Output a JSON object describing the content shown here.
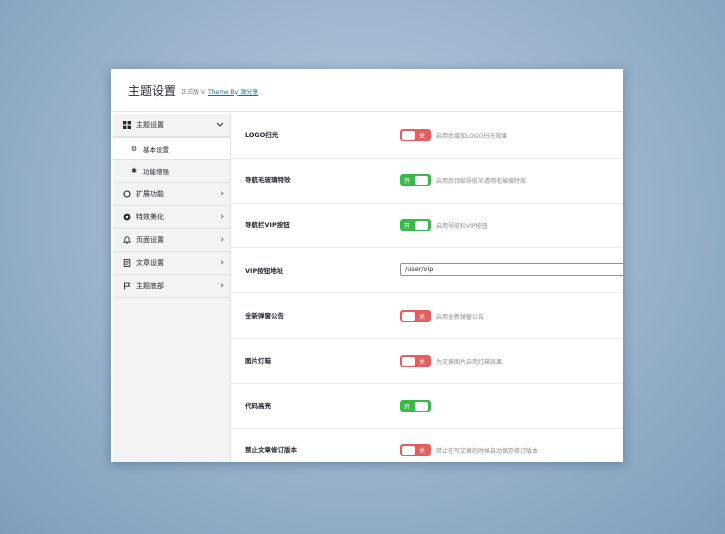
{
  "header": {
    "title": "主题设置",
    "version": "正式版 V",
    "theme_link": "Theme By 源分享"
  },
  "sidebar": {
    "items": [
      {
        "label": "主题设置",
        "icon": "grid-icon",
        "chevron": "﹀",
        "expanded": true,
        "children": [
          {
            "label": "基本设置",
            "icon": "gear-icon",
            "active": true
          },
          {
            "label": "功能增强",
            "icon": "sparkle-icon",
            "active": false
          }
        ]
      },
      {
        "label": "扩展功能",
        "icon": "circle-icon",
        "chevron": "›"
      },
      {
        "label": "特效美化",
        "icon": "dot-circle-icon",
        "chevron": "›"
      },
      {
        "label": "页面设置",
        "icon": "bell-icon",
        "chevron": "›"
      },
      {
        "label": "文章设置",
        "icon": "document-icon",
        "chevron": "›"
      },
      {
        "label": "主题底部",
        "icon": "flag-icon",
        "chevron": "›"
      }
    ]
  },
  "settings": [
    {
      "label": "LOGO扫光",
      "type": "toggle",
      "state": "off",
      "state_text": "关",
      "description": "启用后增加LOGO扫光效果"
    },
    {
      "label": "导航毛玻璃特效",
      "type": "toggle",
      "state": "on",
      "state_text": "开",
      "description": "启用后顶部导航半透明毛玻璃特效"
    },
    {
      "label": "导航栏VIP按钮",
      "type": "toggle",
      "state": "on",
      "state_text": "开",
      "description": "启用导航栏VIP按钮"
    },
    {
      "label": "VIP按钮地址",
      "type": "input",
      "value": "/user/vip"
    },
    {
      "label": "全新弹窗公告",
      "type": "toggle",
      "state": "off",
      "state_text": "关",
      "description": "启用全新弹窗公告"
    },
    {
      "label": "图片灯箱",
      "type": "toggle",
      "state": "off",
      "state_text": "关",
      "description": "为文章图片启用灯箱效果"
    },
    {
      "label": "代码高亮",
      "type": "toggle",
      "state": "on",
      "state_text": "开",
      "description": ""
    },
    {
      "label": "禁止文章修订版本",
      "type": "toggle",
      "state": "off",
      "state_text": "关",
      "description": "禁止在写文章的时候自动保存修订版本"
    }
  ],
  "colors": {
    "toggle_on": "#3cb84a",
    "toggle_off": "#e35f5f",
    "link": "#0073aa"
  }
}
